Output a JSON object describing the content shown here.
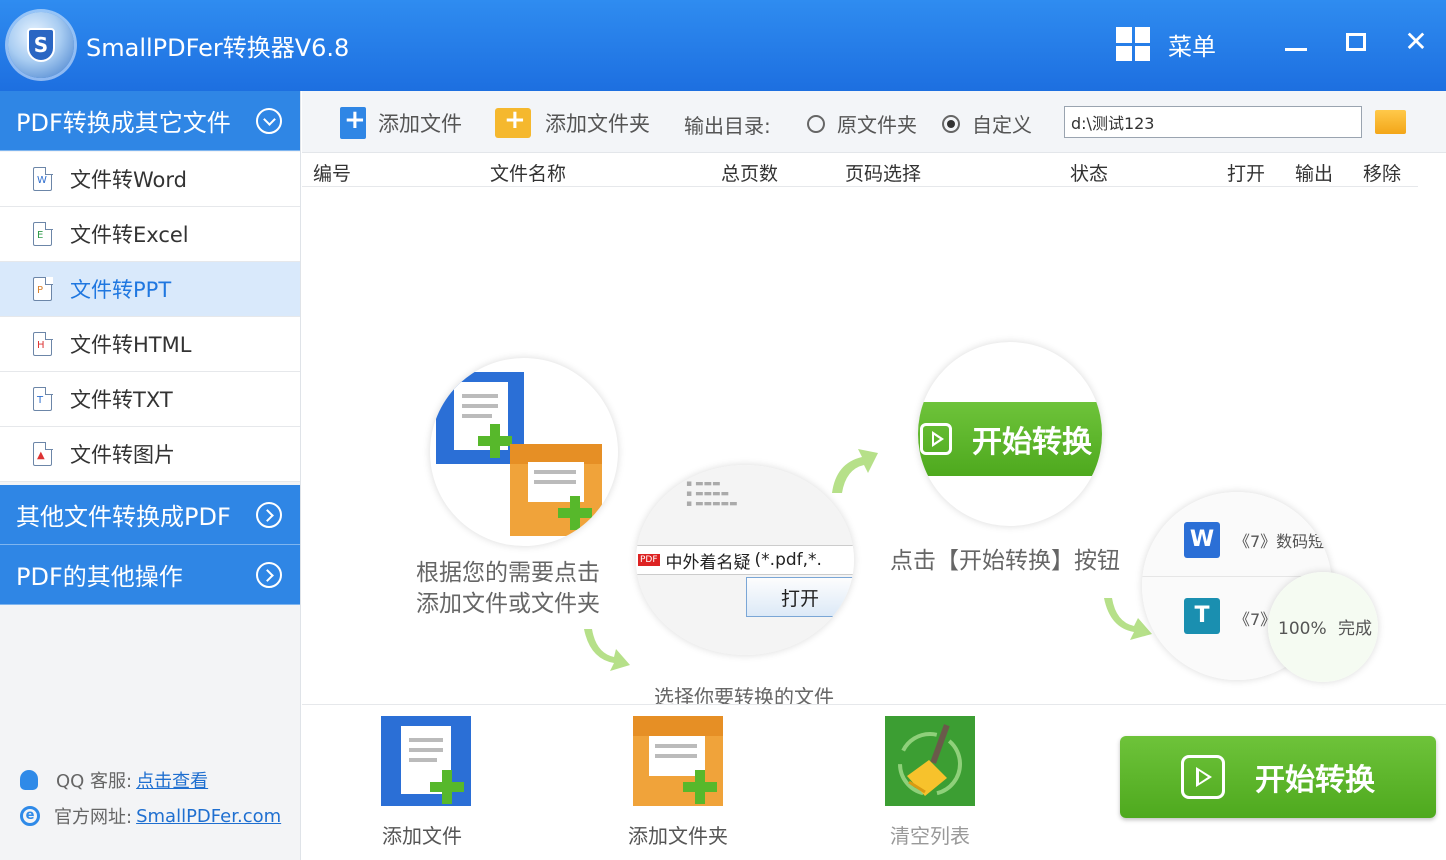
{
  "window": {
    "title": "SmallPDFer转换器V6.8",
    "menu_label": "菜单"
  },
  "sidebar": {
    "sections": [
      {
        "label": "PDF转换成其它文件"
      },
      {
        "label": "其他文件转换成PDF"
      },
      {
        "label": "PDF的其他操作"
      }
    ],
    "items": [
      {
        "label": "文件转Word",
        "icon": "W"
      },
      {
        "label": "文件转Excel",
        "icon": "E"
      },
      {
        "label": "文件转PPT",
        "icon": "P"
      },
      {
        "label": "文件转HTML",
        "icon": "H"
      },
      {
        "label": "文件转TXT",
        "icon": "T"
      },
      {
        "label": "文件转图片",
        "icon": "img"
      }
    ],
    "support": {
      "qq_label": "QQ 客服:",
      "qq_link": "点击查看",
      "site_label": "官方网址:",
      "site_link": "SmallPDFer.com"
    }
  },
  "toolbar": {
    "add_file": "添加文件",
    "add_folder": "添加文件夹",
    "output_label": "输出目录:",
    "radio_original": "原文件夹",
    "radio_custom": "自定义",
    "output_path": "d:\\测试123"
  },
  "table": {
    "headers": [
      "编号",
      "文件名称",
      "总页数",
      "页码选择",
      "状态",
      "打开",
      "输出",
      "移除"
    ]
  },
  "tutorial": {
    "step1_line1": "根据您的需要点击",
    "step1_line2": "添加文件或文件夹",
    "step2_file": "中外着名疑",
    "step2_filter": "(*.pdf,*.",
    "step2_open": "打开",
    "step2_caption": "选择你要转换的文件",
    "step3_button": "开始转换",
    "step3_caption": "点击【开始转换】按钮",
    "step4_row1": "《7》数码短",
    "step4_row2": "《7》",
    "step4_progress": "100%",
    "step4_status": "完成",
    "pdf_tag": "PDF"
  },
  "bottom": {
    "add_file": "添加文件",
    "add_folder": "添加文件夹",
    "clear_list": "清空列表",
    "start": "开始转换"
  },
  "colors": {
    "title_blue": "#1d6fe0",
    "sidebar_blue": "#2f86e5",
    "active_item_bg": "#d9e9fb",
    "start_green": "#5cb32b"
  }
}
